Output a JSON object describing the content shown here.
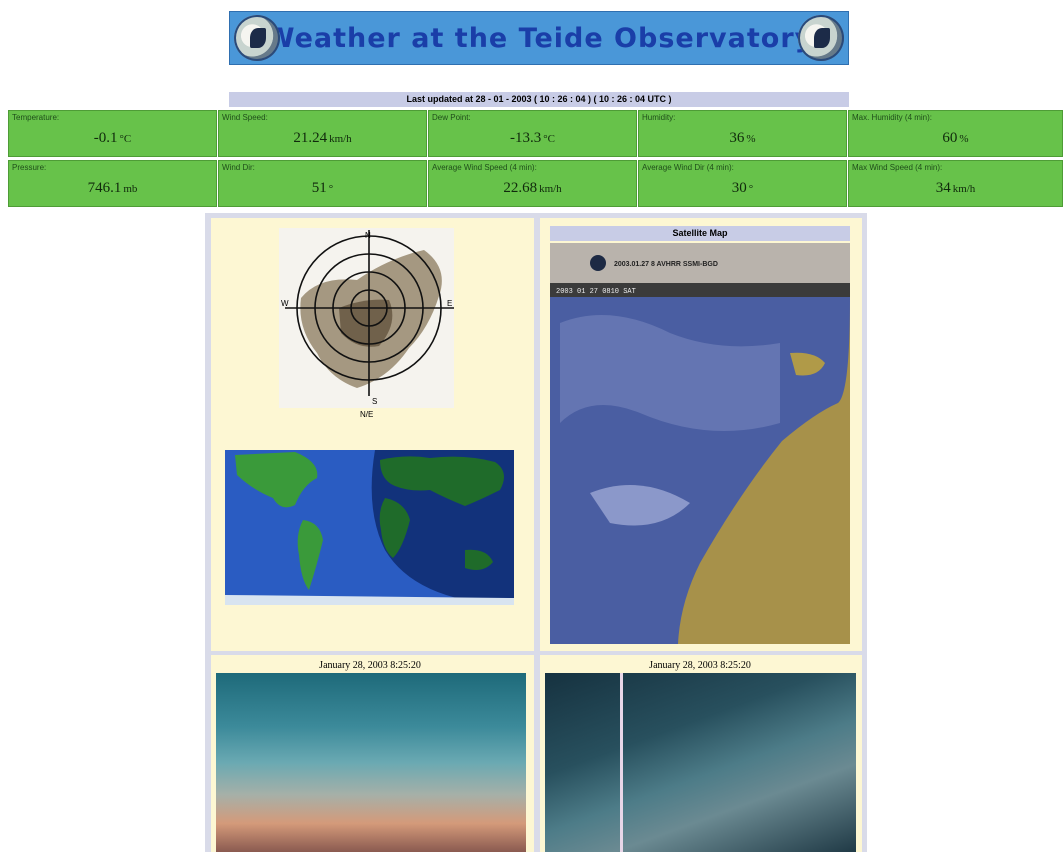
{
  "header": {
    "title": "Weather at the Teide Observatory",
    "last_updated": "Last updated at 28 - 01 - 2003 ( 10 : 26 : 04 ) ( 10 : 26 : 04 UTC )"
  },
  "measurements": [
    {
      "label": "Temperature:",
      "value": "-0.1",
      "unit": "°C"
    },
    {
      "label": "Wind Speed:",
      "value": "21.24",
      "unit": "km/h"
    },
    {
      "label": "Dew Point:",
      "value": "-13.3",
      "unit": "°C"
    },
    {
      "label": "Humidity:",
      "value": "36",
      "unit": "%"
    },
    {
      "label": "Max. Humidity (4 min):",
      "value": "60",
      "unit": "%"
    },
    {
      "label": "Pressure:",
      "value": "746.1",
      "unit": "mb"
    },
    {
      "label": "Wind Dir:",
      "value": "51",
      "unit": "°"
    },
    {
      "label": "Average Wind Speed (4 min):",
      "value": "22.68",
      "unit": "km/h"
    },
    {
      "label": "Average Wind Dir (4 min):",
      "value": "30",
      "unit": "°"
    },
    {
      "label": "Max Wind Speed (4 min):",
      "value": "34",
      "unit": "km/h"
    }
  ],
  "windrose": {
    "labels": {
      "n": "N",
      "e": "E",
      "s": "S",
      "w": "W",
      "caption": "N/E"
    }
  },
  "satellite": {
    "title": "Satellite Map",
    "header_text": "2003.01.27 8 AVHRR SSMI-BGD",
    "strip_text": "2003 01 27 0810 SAT"
  },
  "cameras": [
    {
      "caption": "January 28, 2003 8:25:20"
    },
    {
      "caption": "January 28, 2003 8:25:20"
    }
  ],
  "colors": {
    "banner_bg": "#4a97d8",
    "banner_text": "#1a3ea8",
    "cell_bg": "#67c24a",
    "panel_bg": "#fdf7d3",
    "frame_bg": "#d9dbe9"
  }
}
